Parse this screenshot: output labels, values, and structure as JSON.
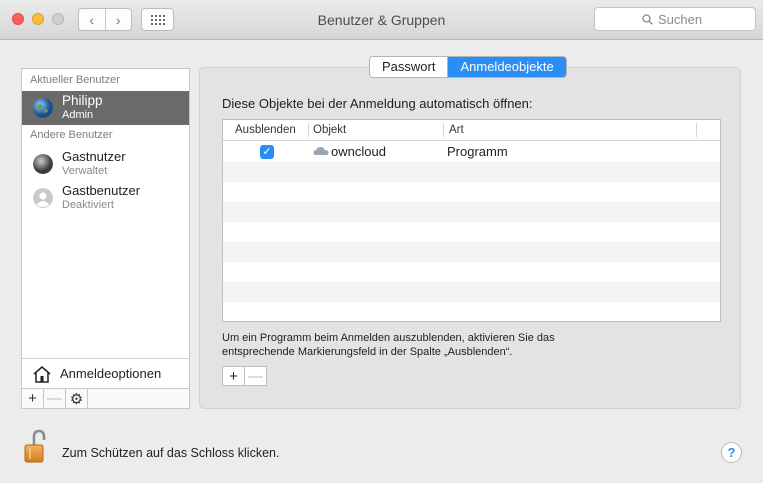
{
  "window": {
    "title": "Benutzer & Gruppen",
    "search_placeholder": "Suchen"
  },
  "sidebar": {
    "current_label": "Aktueller Benutzer",
    "current_user": {
      "name": "Philipp",
      "role": "Admin",
      "icon": "globe-avatar-icon"
    },
    "other_label": "Andere Benutzer",
    "other_users": [
      {
        "name": "Gastnutzer",
        "role": "Verwaltet",
        "icon": "gray-sphere-avatar-icon"
      },
      {
        "name": "Gastbenutzer",
        "role": "Deaktiviert",
        "icon": "person-silhouette-icon"
      }
    ],
    "login_options_label": "Anmeldeoptionen",
    "add_symbol": "+",
    "remove_symbol": "—"
  },
  "tabs": [
    {
      "label": "Passwort",
      "active": false
    },
    {
      "label": "Anmeldeobjekte",
      "active": true
    }
  ],
  "login_items": {
    "heading": "Diese Objekte bei der Anmeldung automatisch öffnen:",
    "columns": [
      "Ausblenden",
      "Objekt",
      "Art"
    ],
    "rows": [
      {
        "hide": true,
        "name": "owncloud",
        "kind": "Programm",
        "icon": "cloud-icon"
      }
    ],
    "hint": "Um ein Programm beim Anmelden auszublenden, aktivieren Sie das entsprechende Markierungsfeld in der Spalte „Ausblenden“.",
    "add_symbol": "+",
    "remove_symbol": "—"
  },
  "footer": {
    "lock_text": "Zum Schützen auf das Schloss klicken.",
    "help_symbol": "?"
  },
  "colors": {
    "accent": "#2a8ef5",
    "selection": "#6a6a6a"
  }
}
